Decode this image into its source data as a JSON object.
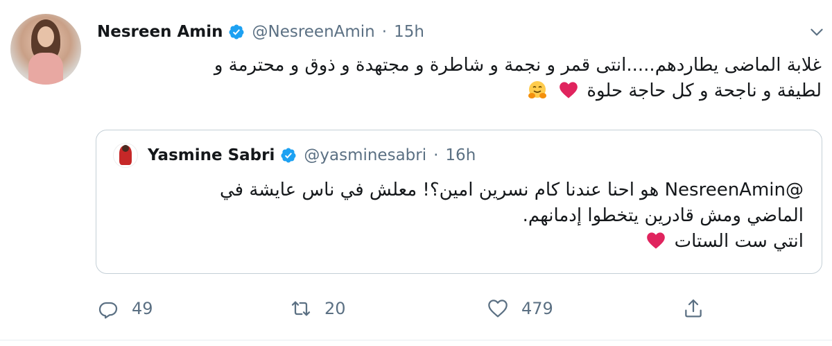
{
  "tweet": {
    "author_name": "Nesreen Amin",
    "author_handle": "@NesreenAmin",
    "separator": "·",
    "time": "15h",
    "text_line1": "غلابة الماضى يطاردهم.....انتى قمر و نجمة و شاطرة و مجتهدة و ذوق و محترمة و",
    "text_line2": "لطيفة و ناجحة و كل حاجة حلوة",
    "emoji": [
      "red-heart",
      "hugging-face"
    ]
  },
  "quote": {
    "author_name": "Yasmine Sabri",
    "author_handle": "@yasminesabri",
    "separator": "·",
    "time": "16h",
    "text_line1": "@NesreenAmin هو احنا عندنا كام نسرين امين؟! معلش في ناس عايشة في",
    "text_line2": "الماضي ومش قادرين يتخطوا إدمانهم.",
    "text_line3": "انتي ست الستات",
    "emoji": [
      "red-heart"
    ]
  },
  "actions": {
    "reply_count": "49",
    "retweet_count": "20",
    "like_count": "479",
    "icons": [
      "reply-icon",
      "retweet-icon",
      "like-icon",
      "share-icon"
    ]
  },
  "colors": {
    "verified": "#1da1f2",
    "muted_text": "#5b7083",
    "border": "#c4cfd6",
    "heart": "#e0245e"
  }
}
